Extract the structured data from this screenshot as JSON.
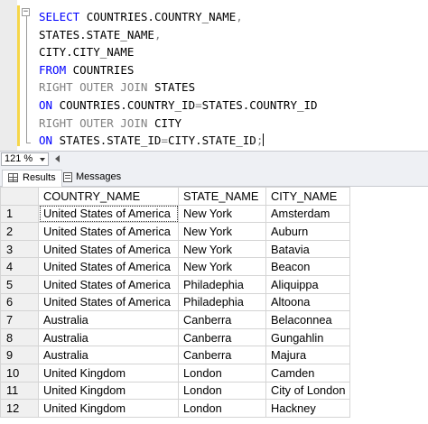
{
  "editor": {
    "lines": [
      [
        {
          "t": "SELECT ",
          "c": "kw"
        },
        {
          "t": "COUNTRIES.COUNTRY_NAME",
          "c": ""
        },
        {
          "t": ",",
          "c": "gray"
        }
      ],
      [
        {
          "t": "STATES.STATE_NAME",
          "c": ""
        },
        {
          "t": ",",
          "c": "gray"
        }
      ],
      [
        {
          "t": "CITY.CITY_NAME",
          "c": ""
        }
      ],
      [
        {
          "t": "FROM ",
          "c": "kw"
        },
        {
          "t": "COUNTRIES",
          "c": ""
        }
      ],
      [
        {
          "t": "RIGHT OUTER JOIN ",
          "c": "gray"
        },
        {
          "t": "STATES",
          "c": ""
        }
      ],
      [
        {
          "t": "ON ",
          "c": "kw"
        },
        {
          "t": "COUNTRIES.COUNTRY_ID",
          "c": ""
        },
        {
          "t": "=",
          "c": "gray"
        },
        {
          "t": "STATES.COUNTRY_ID",
          "c": ""
        }
      ],
      [
        {
          "t": "RIGHT OUTER JOIN ",
          "c": "gray"
        },
        {
          "t": "CITY",
          "c": ""
        }
      ],
      [
        {
          "t": "ON ",
          "c": "kw"
        },
        {
          "t": "STATES.STATE_ID",
          "c": ""
        },
        {
          "t": "=",
          "c": "gray"
        },
        {
          "t": "CITY.STATE_ID",
          "c": ""
        },
        {
          "t": ";",
          "c": "gray"
        }
      ]
    ]
  },
  "zoom": {
    "value": "121 %"
  },
  "tabs": {
    "results_label": "Results",
    "messages_label": "Messages"
  },
  "grid": {
    "columns": [
      "COUNTRY_NAME",
      "STATE_NAME",
      "CITY_NAME"
    ],
    "rows": [
      [
        "1",
        "United States of America",
        "New York",
        "Amsterdam"
      ],
      [
        "2",
        "United States of America",
        "New York",
        "Auburn"
      ],
      [
        "3",
        "United States of America",
        "New York",
        "Batavia"
      ],
      [
        "4",
        "United States of America",
        "New York",
        "Beacon"
      ],
      [
        "5",
        "United States of America",
        "Philadephia",
        "Aliquippa"
      ],
      [
        "6",
        "United States of America",
        "Philadephia",
        "Altoona"
      ],
      [
        "7",
        "Australia",
        "Canberra",
        "Belaconnea"
      ],
      [
        "8",
        "Australia",
        "Canberra",
        "Gungahlin"
      ],
      [
        "9",
        "Australia",
        "Canberra",
        "Majura"
      ],
      [
        "10",
        "United Kingdom",
        "London",
        "Camden"
      ],
      [
        "11",
        "United Kingdom",
        "London",
        "City of London"
      ],
      [
        "12",
        "United Kingdom",
        "London",
        "Hackney"
      ]
    ]
  },
  "colors": {
    "keyword": "#0000ff",
    "operator": "#808080",
    "change_bar": "#f6d64a"
  }
}
